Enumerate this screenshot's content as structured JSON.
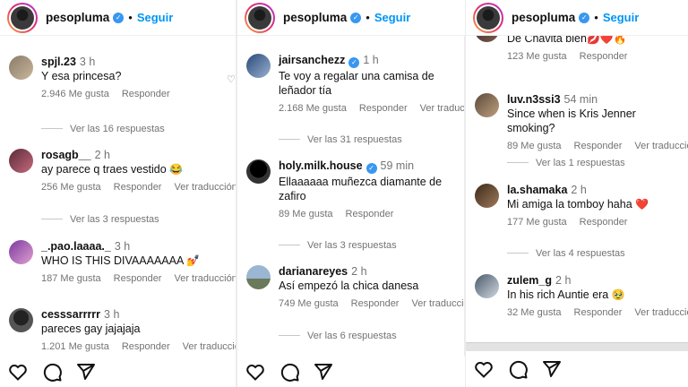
{
  "account": {
    "username": "pesopluma",
    "dot": "•",
    "follow_label": "Seguir"
  },
  "panel1": {
    "comments": [
      {
        "user": "spjl.23",
        "time": "3 h",
        "text": "Y esa princesa?",
        "likes": "2.946 Me gusta",
        "reply": "Responder",
        "translate": "",
        "replies": "Ver las 16 respuestas"
      },
      {
        "user": "rosagb__",
        "time": "2 h",
        "text": "ay parece q traes vestido",
        "emoji": "😂",
        "likes": "256 Me gusta",
        "reply": "Responder",
        "translate": "Ver traducción",
        "replies": "Ver las 3 respuestas"
      },
      {
        "user": "_.pao.laaaa._",
        "time": "3 h",
        "text": "WHO IS THIS DIVAAAAAAA",
        "emoji": "💅",
        "likes": "187 Me gusta",
        "reply": "Responder",
        "translate": "Ver traducción",
        "replies": ""
      },
      {
        "user": "cesssarrrrr",
        "time": "3 h",
        "text": "pareces gay jajajaja",
        "likes": "1.201 Me gusta",
        "reply": "Responder",
        "translate": "Ver traducción",
        "replies": ""
      }
    ]
  },
  "panel2": {
    "comments": [
      {
        "user": "jairsanchezz",
        "verified": true,
        "time": "1 h",
        "text": "Te voy a regalar una camisa de leñador tía",
        "likes": "2.168 Me gusta",
        "reply": "Responder",
        "translate": "Ver traducción",
        "replies": "Ver las 31 respuestas"
      },
      {
        "user": "holy.milk.house",
        "verified": true,
        "time": "59 min",
        "text": "Ellaaaaaa muñezca diamante de zafiro",
        "likes": "89 Me gusta",
        "reply": "Responder",
        "translate": "",
        "replies": "Ver las 3 respuestas"
      },
      {
        "user": "darianareyes",
        "time": "2 h",
        "text": "Así empezó la chica danesa",
        "likes": "749 Me gusta",
        "reply": "Responder",
        "translate": "Ver traducción",
        "replies": "Ver las 6 respuestas"
      }
    ]
  },
  "panel3": {
    "top": {
      "text": "De Chavita bien",
      "emoji": "💋❤️🔥",
      "likes": "123 Me gusta",
      "reply": "Responder"
    },
    "comments": [
      {
        "user": "luv.n3ssi3",
        "time": "54 min",
        "text": "Since when is Kris Jenner smoking?",
        "likes": "89 Me gusta",
        "reply": "Responder",
        "translate": "Ver traducción",
        "replies": "Ver las 1 respuestas"
      },
      {
        "user": "la.shamaka",
        "time": "2 h",
        "text": "Mi amiga la tomboy haha",
        "emoji": "❤️",
        "likes": "177 Me gusta",
        "reply": "Responder",
        "translate": "",
        "replies": "Ver las 4 respuestas"
      },
      {
        "user": "zulem_g",
        "time": "2 h",
        "text": "In his rich Auntie era",
        "emoji": "🥹",
        "likes": "32 Me gusta",
        "reply": "Responder",
        "translate": "Ver traducción",
        "replies": ""
      }
    ]
  }
}
